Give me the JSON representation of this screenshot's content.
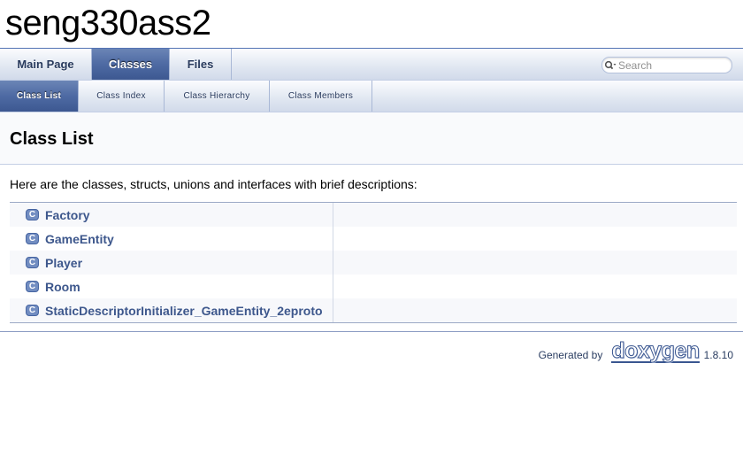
{
  "project": {
    "name": "seng330ass2"
  },
  "main_tabs": [
    {
      "label": "Main Page"
    },
    {
      "label": "Classes"
    },
    {
      "label": "Files"
    }
  ],
  "sub_tabs": [
    {
      "label": "Class List"
    },
    {
      "label": "Class Index"
    },
    {
      "label": "Class Hierarchy"
    },
    {
      "label": "Class Members"
    }
  ],
  "search": {
    "placeholder": "Search",
    "icon": "search-icon"
  },
  "page": {
    "title": "Class List",
    "intro": "Here are the classes, structs, unions and interfaces with brief descriptions:"
  },
  "class_icon_letter": "C",
  "classes": [
    {
      "name": "Factory",
      "description": ""
    },
    {
      "name": "GameEntity",
      "description": ""
    },
    {
      "name": "Player",
      "description": ""
    },
    {
      "name": "Room",
      "description": ""
    },
    {
      "name": "StaticDescriptorInitializer_GameEntity_2eproto",
      "description": ""
    }
  ],
  "footer": {
    "generated_by": "Generated by",
    "logo_text": "doxygen",
    "version": "1.8.10"
  },
  "colors": {
    "tab_active": "#4e6aa3",
    "link": "#3d578c",
    "class_icon": "#728DC1"
  }
}
